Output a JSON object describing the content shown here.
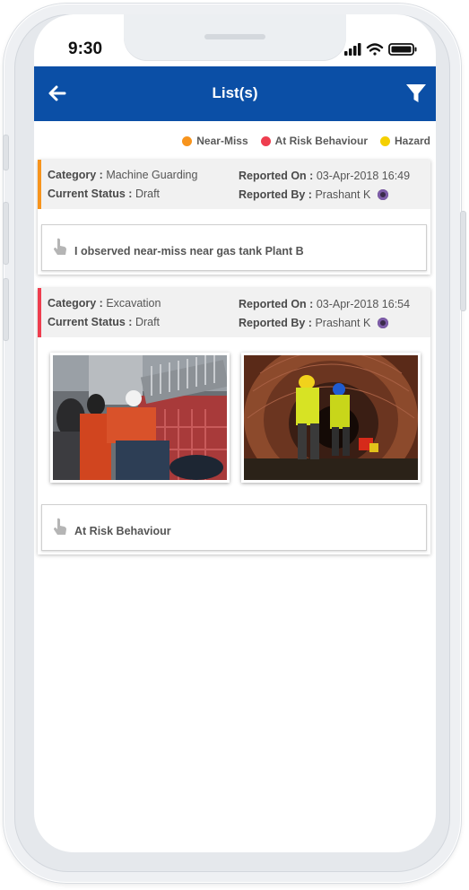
{
  "status_bar": {
    "time": "9:30"
  },
  "app_bar": {
    "title": "List(s)",
    "back_icon": "arrow-left-icon",
    "filter_icon": "filter-icon"
  },
  "legend": [
    {
      "label": "Near-Miss",
      "color": "#f7941d"
    },
    {
      "label": "At Risk Behaviour",
      "color": "#ee3e4f"
    },
    {
      "label": "Hazard",
      "color": "#f5d000"
    }
  ],
  "labels": {
    "category": "Category :",
    "current_status": "Current Status :",
    "reported_on": "Reported On :",
    "reported_by": "Reported By :"
  },
  "cards": [
    {
      "type_color": "#f7941d",
      "category": "Machine Guarding",
      "status": "Draft",
      "reported_on": "03-Apr-2018 16:49",
      "reported_by": "Prashant K",
      "description": "I observed near-miss near gas tank Plant B"
    },
    {
      "type_color": "#ee3e4f",
      "category": "Excavation",
      "status": "Draft",
      "reported_on": "03-Apr-2018 16:54",
      "reported_by": "Prashant K",
      "description": "At Risk Behaviour",
      "photos": [
        "workers-with-machinery-photo",
        "tunnel-workers-photo"
      ]
    }
  ]
}
